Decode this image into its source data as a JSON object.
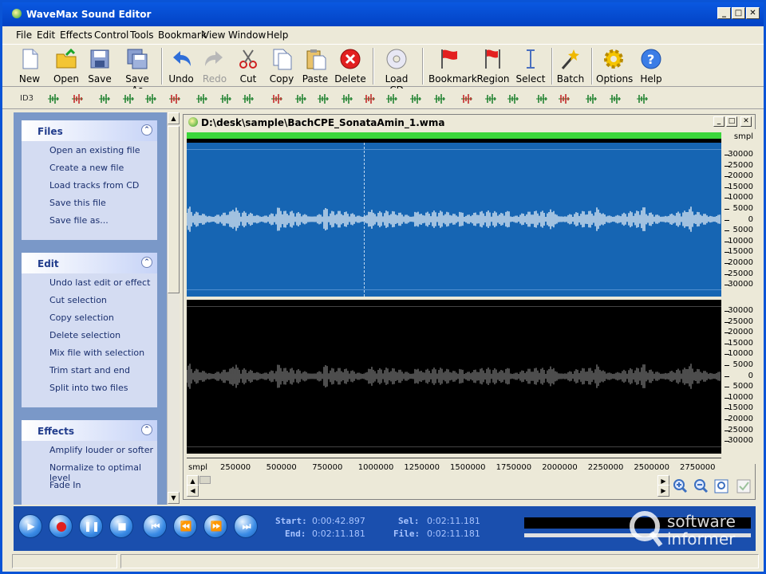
{
  "window": {
    "title": "WaveMax Sound Editor"
  },
  "menu": [
    "File",
    "Edit",
    "Effects",
    "Control",
    "Tools",
    "Bookmark",
    "View",
    "Window",
    "Help"
  ],
  "toolbar": {
    "new": "New",
    "open": "Open",
    "save": "Save",
    "save_as": "Save As",
    "undo": "Undo",
    "redo": "Redo",
    "cut": "Cut",
    "copy": "Copy",
    "paste": "Paste",
    "delete": "Delete",
    "load_cd": "Load CD",
    "bookmark": "Bookmark",
    "region": "Region",
    "select": "Select",
    "batch": "Batch",
    "options": "Options",
    "help": "Help"
  },
  "toolbar2": {
    "id3": "ID3"
  },
  "sidebar": {
    "files": {
      "title": "Files",
      "items": [
        "Open an existing file",
        "Create a new file",
        "Load tracks from CD",
        "Save this file",
        "Save file as..."
      ]
    },
    "edit": {
      "title": "Edit",
      "items": [
        "Undo last edit or effect",
        "Cut selection",
        "Copy selection",
        "Delete selection",
        "Mix file with selection",
        "Trim start and end",
        "Split into two files"
      ]
    },
    "effects": {
      "title": "Effects",
      "items": [
        "Amplify louder or softer",
        "Normalize to optimal level",
        "Fade In"
      ]
    }
  },
  "document": {
    "title": "D:\\desk\\sample\\BachCPE_SonataAmin_1.wma"
  },
  "ruler": {
    "unit": "smpl",
    "track1": [
      "30000",
      "25000",
      "20000",
      "15000",
      "10000",
      "5000",
      "0",
      "5000",
      "10000",
      "15000",
      "20000",
      "25000",
      "30000"
    ],
    "track2": [
      "30000",
      "25000",
      "20000",
      "15000",
      "10000",
      "5000",
      "0",
      "5000",
      "10000",
      "15000",
      "20000",
      "25000",
      "30000"
    ]
  },
  "hruler": {
    "unit": "smpl",
    "labels": [
      "250000",
      "500000",
      "750000",
      "1000000",
      "1250000",
      "1500000",
      "1750000",
      "2000000",
      "2250000",
      "2500000",
      "2750000"
    ]
  },
  "transport": {
    "start_label": "Start:",
    "start_value": "0:00:42.897",
    "end_label": "End:",
    "end_value": "0:02:11.181",
    "sel_label": "Sel:",
    "sel_value": "0:02:11.181",
    "file_label": "File:",
    "file_value": "0:02:11.181"
  },
  "watermark": {
    "line1": "software",
    "line2": "informer"
  },
  "colors": {
    "track_active": "#1665b3",
    "track_inactive": "#000000",
    "wave_active": "#ffffff",
    "wave_inactive": "#808080",
    "selection_bar": "#3bd63b"
  }
}
